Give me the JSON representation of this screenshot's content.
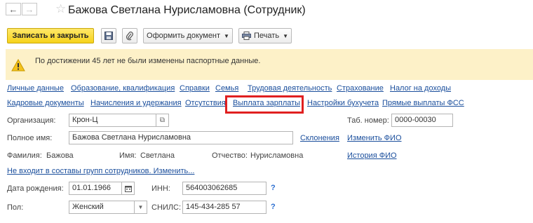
{
  "header": {
    "back_icon": "arrow-left-icon",
    "forward_icon": "arrow-right-icon",
    "favorite_icon": "star-icon",
    "title": "Бажова Светлана Нурисламовна (Сотрудник)"
  },
  "toolbar": {
    "save_close_label": "Записать и закрыть",
    "save_icon": "floppy-icon",
    "attach_icon": "paperclip-icon",
    "document_label": "Оформить документ",
    "print_label": "Печать",
    "print_icon": "printer-icon"
  },
  "warning": {
    "text": "По достижении 45 лет не были изменены паспортные данные.",
    "icon": "warning-icon",
    "color": "#fdf1c8"
  },
  "tabs_row1": [
    "Личные данные",
    "Образование, квалификация",
    "Справки",
    "Семья",
    "Трудовая деятельность",
    "Страхование",
    "Налог на доходы"
  ],
  "tabs_row2": [
    "Кадровые документы",
    "Начисления и удержания",
    "Отсутствия",
    "Выплата зарплаты",
    "Настройки бухучета",
    "Прямые выплаты ФСС"
  ],
  "form": {
    "org_label": "Организация:",
    "org_value": "Крон-Ц",
    "tab_label": "Таб. номер:",
    "tab_value": "0000-00030",
    "fullname_label": "Полное имя:",
    "fullname_value": "Бажова Светлана Нурисламовна",
    "declensions_link": "Склонения",
    "change_fio_link": "Изменить ФИО",
    "surname_label": "Фамилия:",
    "surname_value": "Бажова",
    "name_label": "Имя:",
    "name_value": "Светлана",
    "patronymic_label": "Отчество:",
    "patronymic_value": "Нурисламовна",
    "history_link": "История ФИО",
    "groups_link": "Не входит в составы групп сотрудников. Изменить...",
    "birth_label": "Дата рождения:",
    "birth_value": "01.01.1966",
    "inn_label": "ИНН:",
    "inn_value": "564003062685",
    "gender_label": "Пол:",
    "gender_value": "Женский",
    "snils_label": "СНИЛС:",
    "snils_value": "145-434-285 57",
    "help_mark": "?"
  },
  "highlight_color": "#e02020"
}
